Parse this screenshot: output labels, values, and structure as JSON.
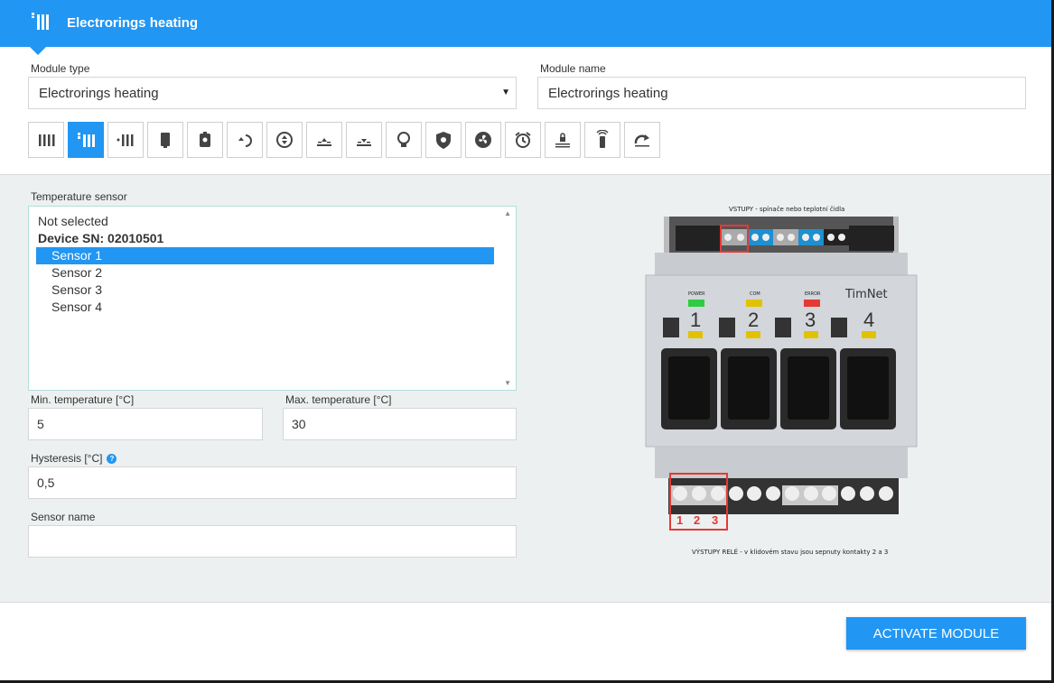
{
  "header": {
    "title": "Electrorings heating",
    "icon": "radiator-icon",
    "color": "#2196f3"
  },
  "module_type": {
    "label": "Module type",
    "value": "Electrorings heating"
  },
  "module_name": {
    "label": "Module name",
    "value": "Electrorings heating"
  },
  "module_icons": [
    {
      "name": "radiator-icon"
    },
    {
      "name": "electro-radiator-icon",
      "active": true
    },
    {
      "name": "heating-dots-icon"
    },
    {
      "name": "boiler-icon"
    },
    {
      "name": "water-heater-icon"
    },
    {
      "name": "recirculation-icon"
    },
    {
      "name": "pump-icon"
    },
    {
      "name": "floor-heating-icon"
    },
    {
      "name": "floor-cooling-icon"
    },
    {
      "name": "light-bulb-icon"
    },
    {
      "name": "shield-icon"
    },
    {
      "name": "fan-icon"
    },
    {
      "name": "alarm-clock-icon"
    },
    {
      "name": "lock-icon"
    },
    {
      "name": "remote-control-icon"
    },
    {
      "name": "redo-arrow-icon"
    }
  ],
  "temperature_sensor": {
    "label": "Temperature sensor",
    "items": [
      {
        "text": "Not selected"
      },
      {
        "text": "Device SN: 02010501",
        "bold": true
      },
      {
        "text": "Sensor 1",
        "selected": true
      },
      {
        "text": "Sensor 2"
      },
      {
        "text": "Sensor 3"
      },
      {
        "text": "Sensor 4"
      }
    ]
  },
  "min_temp": {
    "label": "Min. temperature [°C]",
    "value": "5"
  },
  "max_temp": {
    "label": "Max. temperature [°C]",
    "value": "30"
  },
  "hysteresis": {
    "label": "Hysteresis [°C]",
    "value": "0,5"
  },
  "sensor_name": {
    "label": "Sensor name",
    "value": ""
  },
  "device": {
    "inputs_caption": "VSTUPY - spínače nebo teplotní čidla",
    "outputs_caption": "VÝSTUPY RELÉ - v klidovém stavu jsou sepnuty kontakty 2 a 3",
    "brand": "TimNet",
    "leds": [
      "POWER",
      "COM",
      "ERROR"
    ],
    "channels": [
      "1",
      "2",
      "3",
      "4"
    ],
    "terminals": [
      "1",
      "2",
      "3"
    ]
  },
  "actions": {
    "activate": "ACTIVATE MODULE"
  }
}
